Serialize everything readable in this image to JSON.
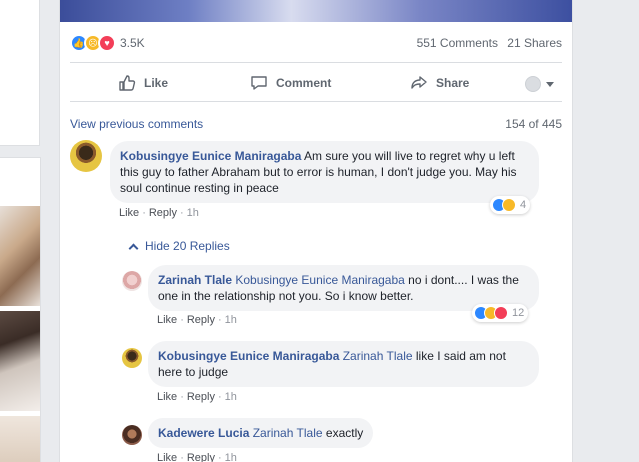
{
  "post": {
    "reaction_count": "3.5K",
    "comments_count": "551 Comments",
    "shares_count": "21 Shares",
    "actions": {
      "like": "Like",
      "comment": "Comment",
      "share": "Share"
    }
  },
  "comments_header": {
    "view_previous": "View previous comments",
    "counter": "154 of 445"
  },
  "main_comment": {
    "author": "Kobusingye Eunice Maniragaba",
    "text": "Am sure you will live to regret why u left this guy to father Abraham but to error is human, I don't judge you. May his soul continue resting in peace",
    "like": "Like",
    "reply": "Reply",
    "time": "1h",
    "reactions": "4"
  },
  "hide_replies": "Hide 20 Replies",
  "replies": [
    {
      "author": "Zarinah Tlale",
      "mention": "Kobusingye Eunice Maniragaba",
      "text": "no i dont.... I was the one in the relationship not you. So i know better.",
      "like": "Like",
      "reply": "Reply",
      "time": "1h",
      "reactions": "12"
    },
    {
      "author": "Kobusingye Eunice Maniragaba",
      "mention": "Zarinah Tlale",
      "text": "like I said am not here to judge",
      "like": "Like",
      "reply": "Reply",
      "time": "1h"
    },
    {
      "author": "Kadewere Lucia",
      "mention": "Zarinah Tlale",
      "text": "exactly",
      "like": "Like",
      "reply": "Reply",
      "time": "1h"
    }
  ],
  "colors": {
    "link": "#385898",
    "like_blue": "#2d88ff",
    "love_red": "#f33e58",
    "haha_yellow": "#f7b928"
  }
}
